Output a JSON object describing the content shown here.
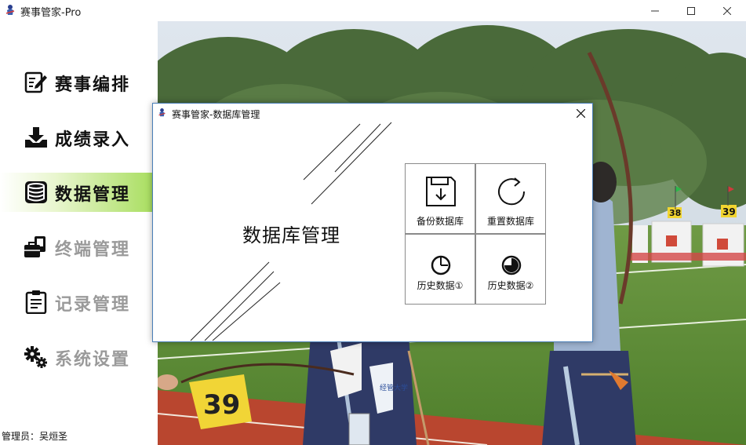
{
  "window": {
    "title": "赛事管家-Pro"
  },
  "sidebar": {
    "items": [
      {
        "label": "赛事编排",
        "icon": "edit-document-icon",
        "state": "normal"
      },
      {
        "label": "成绩录入",
        "icon": "download-tray-icon",
        "state": "normal"
      },
      {
        "label": "数据管理",
        "icon": "database-icon",
        "state": "active"
      },
      {
        "label": "终端管理",
        "icon": "terminal-devices-icon",
        "state": "disabled"
      },
      {
        "label": "记录管理",
        "icon": "clipboard-icon",
        "state": "disabled"
      },
      {
        "label": "系统设置",
        "icon": "gears-icon",
        "state": "disabled"
      }
    ],
    "admin_label": "管理员：吴烜圣"
  },
  "background": {
    "target_numbers": [
      "39",
      "38",
      "39"
    ],
    "bib_text": "经管大学"
  },
  "dialog": {
    "title": "赛事管家-数据库管理",
    "heading": "数据库管理",
    "tiles": [
      {
        "label": "备份数据库",
        "icon": "floppy-save-icon"
      },
      {
        "label": "重置数据库",
        "icon": "refresh-icon"
      },
      {
        "label": "历史数据①",
        "icon": "history-dial-icon"
      },
      {
        "label": "历史数据②",
        "icon": "history-pie-icon"
      }
    ]
  },
  "colors": {
    "active_nav_gradient_end": "#a6dd5b",
    "dialog_border": "#4a7fb8",
    "disabled_text": "#9a9a9a"
  }
}
